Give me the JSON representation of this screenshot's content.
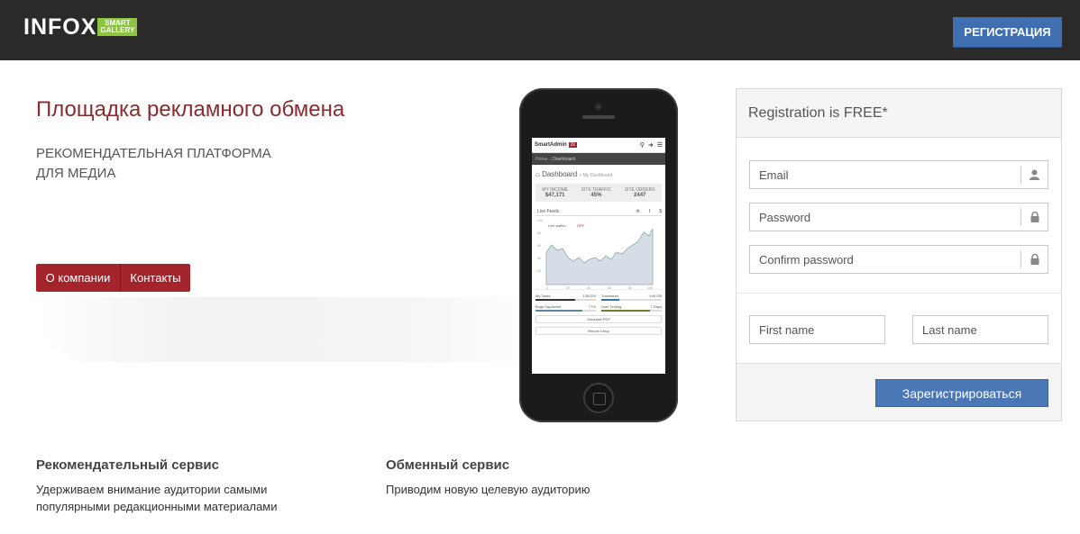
{
  "header": {
    "logo_text": "INFOX",
    "logo_badge_line1": "SMART",
    "logo_badge_line2": "GALLERY",
    "register_label": "РЕГИСТРАЦИЯ"
  },
  "hero": {
    "title": "Площадка рекламного обмена",
    "subtitle_line1": "РЕКОМЕНДАТЕЛЬНАЯ ПЛАТФОРМА",
    "subtitle_line2": "ДЛЯ МЕДИА",
    "buttons": [
      "О компании",
      "Контакты"
    ]
  },
  "phone_screen": {
    "app_name": "SmartAdmin",
    "badge": "2k",
    "crumb_home": "Home",
    "crumb_page": "Dashboard",
    "dash_title": "Dashboard",
    "dash_sub": "> My Dashboard",
    "stats": [
      {
        "label": "MY INCOME",
        "value": "$47,171"
      },
      {
        "label": "SITE TRAFFIC",
        "value": "45%"
      },
      {
        "label": "SITE ORDERS",
        "value": "2447"
      }
    ],
    "tab_label": "Live Feeds",
    "chart_label": "Live switch",
    "chart_toggle": "OFF",
    "y_ticks": [
      "100",
      "80",
      "60",
      "40",
      "20"
    ],
    "x_ticks": [
      "0",
      "20",
      "40",
      "60",
      "80",
      "100"
    ],
    "bars": [
      {
        "label": "My Tasks",
        "value": "130/200",
        "color": "#333333",
        "fill": 0.65
      },
      {
        "label": "Transfered",
        "value": "440 GB",
        "color": "#3276b1",
        "fill": 0.3
      },
      {
        "label": "Bugs Squashed",
        "value": "77%",
        "color": "#57889c",
        "fill": 0.77
      },
      {
        "label": "User Testing",
        "value": "7 Days",
        "color": "#6e7d32",
        "fill": 0.8
      }
    ],
    "btn1": "Generate PDF",
    "btn2": "Report a bug"
  },
  "registration": {
    "title": "Registration is FREE*",
    "email_placeholder": "Email",
    "password_placeholder": "Password",
    "confirm_placeholder": "Confirm password",
    "first_name_placeholder": "First name",
    "last_name_placeholder": "Last name",
    "submit_label": "Зарегистрироваться"
  },
  "features": [
    {
      "title": "Рекомендательный сервис",
      "text_line1": "Удерживаем внимание аудитории самыми",
      "text_line2": "популярными редакционными материалами"
    },
    {
      "title": "Обменный сервис",
      "text_line1": "Приводим новую целевую аудиторию",
      "text_line2": ""
    }
  ],
  "colors": {
    "header_bg": "#2b2a29",
    "brand_red": "#8a2b2e",
    "button_red": "#a4242c",
    "accent_blue": "#3f6fb1",
    "logo_green": "#8cc63f"
  }
}
